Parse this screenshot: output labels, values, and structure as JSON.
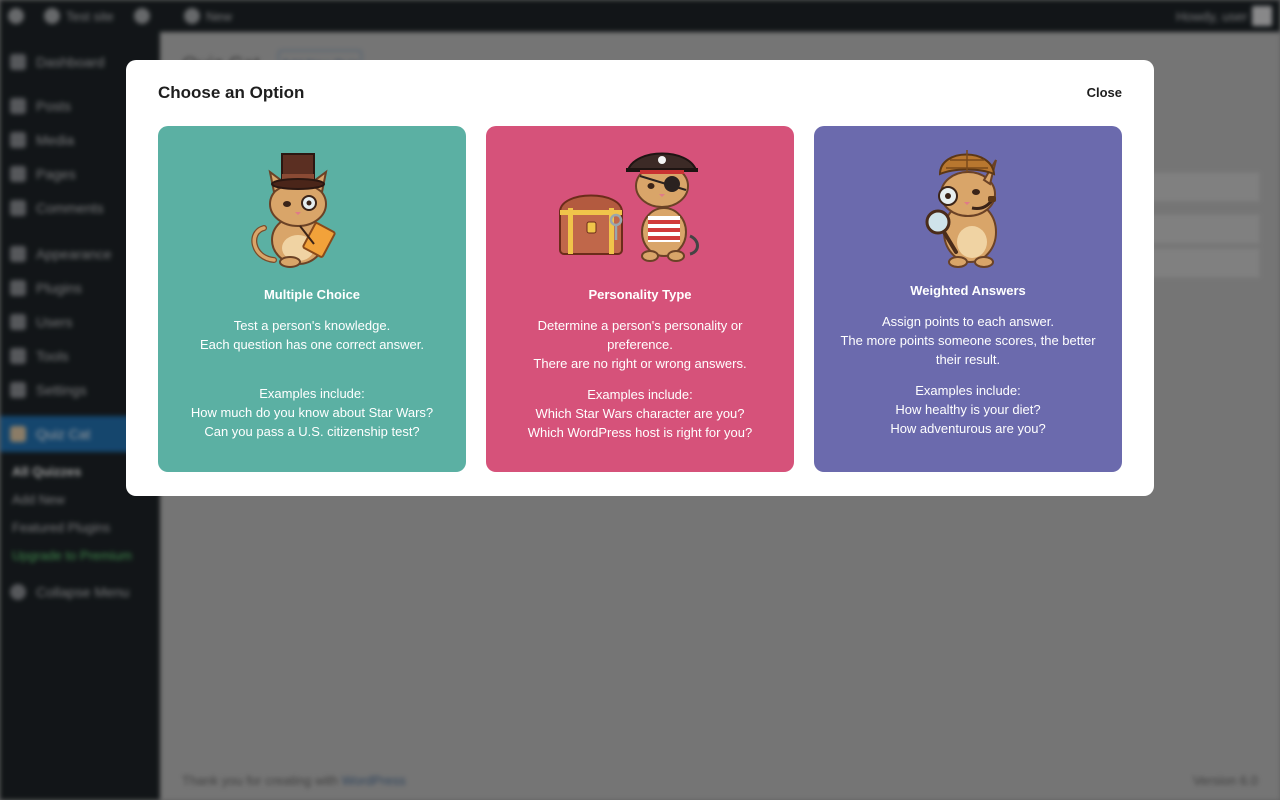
{
  "background": {
    "adminbar": {
      "site_name": "Test site",
      "new_label": "New",
      "user_label": "Howdy, user"
    },
    "sidebar": {
      "items": [
        {
          "label": "Dashboard",
          "icon": "dashboard-icon"
        },
        {
          "label": "Posts",
          "icon": "pin-icon"
        },
        {
          "label": "Media",
          "icon": "media-icon"
        },
        {
          "label": "Pages",
          "icon": "page-icon"
        },
        {
          "label": "Comments",
          "icon": "comment-icon"
        },
        {
          "label": "Appearance",
          "icon": "brush-icon"
        },
        {
          "label": "Plugins",
          "icon": "plugin-icon"
        },
        {
          "label": "Users",
          "icon": "user-icon"
        },
        {
          "label": "Tools",
          "icon": "wrench-icon"
        },
        {
          "label": "Settings",
          "icon": "settings-icon"
        }
      ],
      "active_item": "Quiz Cat",
      "sub_items": [
        "All Quizzes",
        "Add New",
        "Featured Plugins",
        "Upgrade to Premium"
      ],
      "collapse_label": "Collapse Menu"
    },
    "main": {
      "page_title": "Quiz Cat",
      "add_new_label": "Add New Quiz",
      "footer_text": "Thank you for creating with",
      "footer_link": "WordPress",
      "version": "Version 6.0"
    }
  },
  "modal": {
    "title": "Choose an Option",
    "close_label": "Close",
    "colors": {
      "multiple_choice": "#5bb0a3",
      "personality": "#d6527a",
      "weighted": "#6b6aad"
    },
    "cards": [
      {
        "title": "Multiple Choice",
        "illustration": "cat-top-hat-notepad-icon",
        "description": [
          "Test a person's knowledge.",
          "Each question has one correct answer."
        ],
        "examples": [
          "Examples include:",
          "How much do you know about Star Wars?",
          "Can you pass a U.S. citizenship test?"
        ]
      },
      {
        "title": "Personality Type",
        "illustration": "pirate-cat-treasure-chest-icon",
        "description": [
          "Determine a person's personality or preference.",
          "There are no right or wrong answers."
        ],
        "examples": [
          "Examples include:",
          "Which Star Wars character are you?",
          "Which WordPress host is right for you?"
        ]
      },
      {
        "title": "Weighted Answers",
        "illustration": "detective-cat-magnifier-icon",
        "description": [
          "Assign points to each answer.",
          "The more points someone scores, the better their result."
        ],
        "examples": [
          "Examples include:",
          "How healthy is your diet?",
          "How adventurous are you?"
        ]
      }
    ]
  }
}
